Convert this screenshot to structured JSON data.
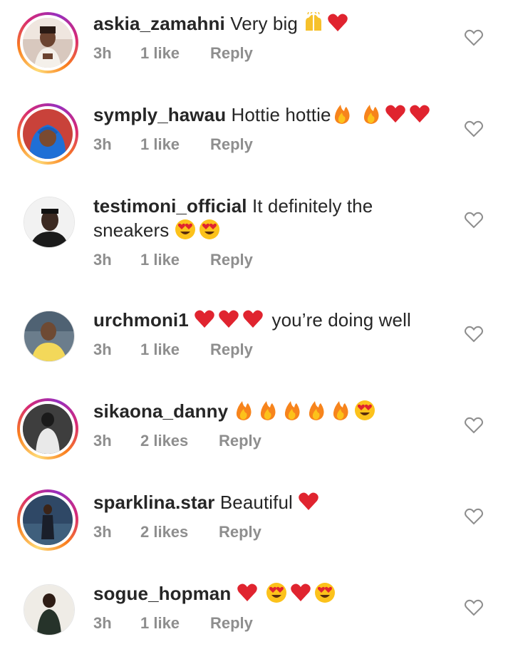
{
  "labels": {
    "reply": "Reply"
  },
  "comments": [
    {
      "username": "askia_zamahni",
      "text": "Very big",
      "emojis": [
        "raised-hands",
        "heart"
      ],
      "time": "3h",
      "likes": "1 like",
      "avatar": "askia",
      "ring": true
    },
    {
      "username": "symply_hawau",
      "text": "Hottie hottie",
      "emojis": [
        "fire",
        "fire",
        "heart",
        "heart"
      ],
      "time": "3h",
      "likes": "1 like",
      "avatar": "hawau",
      "ring": true
    },
    {
      "username": "testimoni_official",
      "text": "It definitely the",
      "text2": "sneakers",
      "emojis": [
        "heart-eyes",
        "heart-eyes"
      ],
      "time": "3h",
      "likes": "1 like",
      "avatar": "testimoni",
      "ring": false
    },
    {
      "username": "urchmoni1",
      "text": "you’re doing well",
      "emojis_before": [
        "heart",
        "heart",
        "heart"
      ],
      "time": "3h",
      "likes": "1 like",
      "avatar": "urchmoni",
      "ring": false
    },
    {
      "username": "sikaona_danny",
      "text": "",
      "emojis": [
        "fire",
        "fire",
        "fire",
        "fire",
        "fire",
        "heart-eyes"
      ],
      "time": "3h",
      "likes": "2 likes",
      "avatar": "sikaona",
      "ring": true
    },
    {
      "username": "sparklina.star",
      "text": "Beautiful",
      "emojis": [
        "heart"
      ],
      "time": "3h",
      "likes": "2 likes",
      "avatar": "sparklina",
      "ring": true
    },
    {
      "username": "sogue_hopman",
      "text": "",
      "emojis": [
        "heart",
        "heart-eyes",
        "heart",
        "heart-eyes"
      ],
      "time": "3h",
      "likes": "1 like",
      "avatar": "sogue",
      "ring": false
    }
  ],
  "colors": {
    "meta": "#8e8e8e",
    "text": "#262626",
    "heart": "#e0242f"
  }
}
